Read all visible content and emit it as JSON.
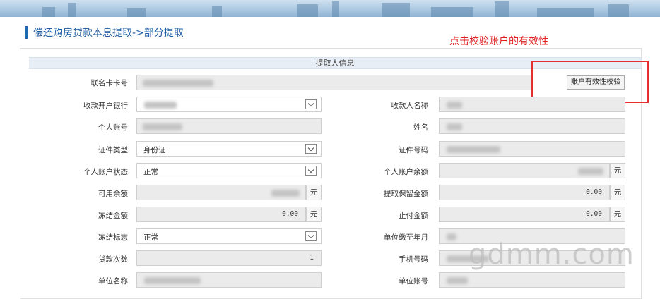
{
  "page": {
    "title": "偿还购房贷款本息提取->部分提取"
  },
  "annotation": {
    "text": "点击校验账户的有效性",
    "color": "#e02020"
  },
  "panel": {
    "header": "提取人信息"
  },
  "fields": {
    "joint_card_no": {
      "label": "联名卡卡号"
    },
    "verify_button": {
      "label": "账户有效性校验"
    },
    "receiving_bank": {
      "label": "收款开户银行"
    },
    "payee_name": {
      "label": "收款人名称"
    },
    "personal_account": {
      "label": "个人账号"
    },
    "name": {
      "label": "姓名"
    },
    "id_type": {
      "label": "证件类型",
      "value": "身份证"
    },
    "id_number": {
      "label": "证件号码"
    },
    "account_status": {
      "label": "个人账户状态",
      "value": "正常"
    },
    "account_balance": {
      "label": "个人账户余额",
      "unit": "元"
    },
    "available_balance": {
      "label": "可用余额",
      "unit": "元"
    },
    "withdraw_reserve": {
      "label": "提取保留金额",
      "value": "0.00",
      "unit": "元"
    },
    "frozen_amount": {
      "label": "冻结金额",
      "value": "0.00",
      "unit": "元"
    },
    "stop_payment_amount": {
      "label": "止付金额",
      "value": "0.00",
      "unit": "元"
    },
    "freeze_flag": {
      "label": "冻结标志",
      "value": "正常"
    },
    "unit_paid_month": {
      "label": "单位缴至年月"
    },
    "loan_count": {
      "label": "贷款次数",
      "value": "1"
    },
    "mobile": {
      "label": "手机号码"
    },
    "company_name": {
      "label": "单位名称"
    },
    "company_account": {
      "label": "单位账号"
    }
  },
  "watermark": "gdmm.com"
}
